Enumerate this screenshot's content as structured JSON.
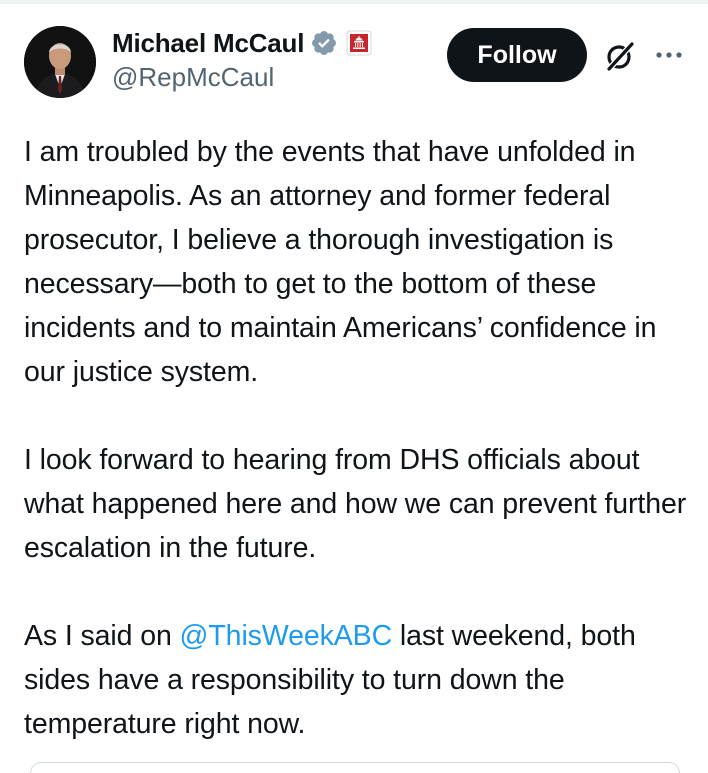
{
  "author": {
    "display_name": "Michael McCaul",
    "handle": "@RepMcCaul",
    "verified_badge": "verified-badge-icon",
    "affiliation_badge": "us-capitol-badge-icon"
  },
  "actions": {
    "follow_label": "Follow",
    "grok_icon": "grok-icon",
    "more_icon": "more-icon"
  },
  "tweet": {
    "paragraph1": "I am troubled by the events that have unfolded in Minneapolis. As an attorney and former federal prosecutor, I believe a thorough investigation is necessary—both to get to the bottom of these incidents and to maintain Americans’ confidence in our justice system.",
    "paragraph2": "I look forward to hearing from DHS officials about what happened here and how we can prevent further escalation in the future.",
    "paragraph3_before": "As I said on ",
    "mention": "@ThisWeekABC",
    "paragraph3_after": " last weekend, both sides have a responsibility to turn down the temperature right now."
  },
  "colors": {
    "text": "#0f1419",
    "secondary_text": "#536471",
    "link": "#1d9bf0",
    "verified": "#829aab",
    "gov_badge": "#c9262c",
    "button_bg": "#0f1419"
  }
}
